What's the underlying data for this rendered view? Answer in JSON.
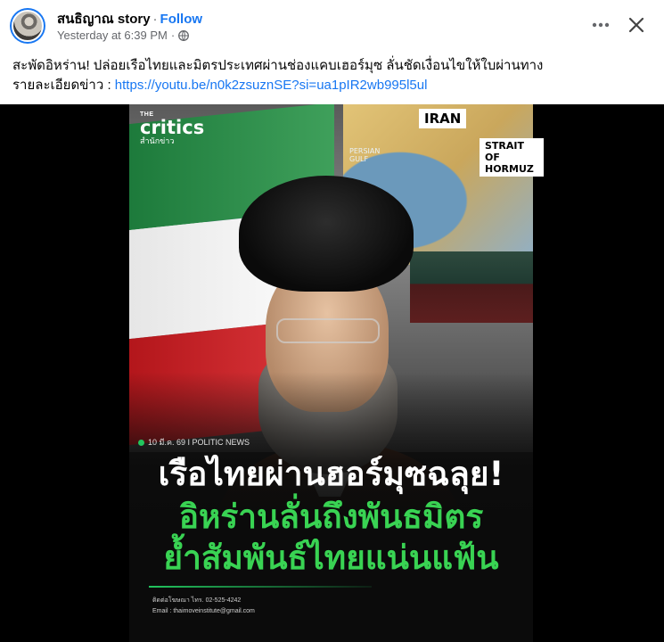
{
  "post": {
    "author": "สนธิญาณ story",
    "separator": "·",
    "follow_label": "Follow",
    "timestamp": "Yesterday at 6:39 PM",
    "meta_separator": "·",
    "privacy_icon": "globe-icon",
    "text_line1": "สะพัดอิหร่าน! ปล่อยเรือไทยและมิตรประเทศผ่านช่องแคบเฮอร์มุซ ลั่นชัดเงื่อนไขให้ใบผ่านทาง",
    "text_line2_prefix": "รายละเอียดข่าว : ",
    "link": "https://youtu.be/n0k2zsuznSE?si=ua1pIR2wb995l5ul"
  },
  "controls": {
    "more_icon": "more-horizontal-icon",
    "close_icon": "close-icon"
  },
  "image": {
    "brand_the": "THE",
    "brand_name": "critics",
    "brand_sub": "สำนักข่าว",
    "map_label_iran": "IRAN",
    "map_label_strait": "STRAIT OF HORMUZ",
    "map_label_gulf_1": "PERSIAN",
    "map_label_gulf_2": "GULF",
    "dateline": "10 มี.ค. 69 I POLITIC NEWS",
    "headline_1": "เรือไทยผ่านฮอร์มุซฉลุย!",
    "headline_2": "อิหร่านลั่นถึงพันธมิตร",
    "headline_3": "ย้ำสัมพันธ์ไทยแน่นแฟ้น",
    "contact_phone": "ติดต่อโฆษณา ไทร. 02-525-4242",
    "contact_email": "Email : thaimoveinstitute@gmail.com"
  },
  "colors": {
    "link": "#1877f2",
    "accent_green": "#39d353",
    "text_primary": "#050505",
    "text_secondary": "#65676b"
  }
}
